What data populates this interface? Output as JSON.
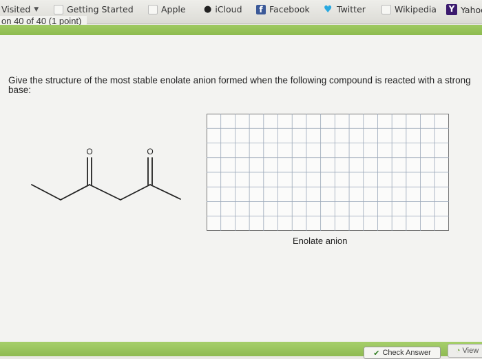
{
  "bookmarks": {
    "most_visited": "Visited",
    "items": [
      {
        "label": "Getting Started",
        "icon": "page-icon"
      },
      {
        "label": "Apple",
        "icon": "page-icon"
      },
      {
        "label": "iCloud",
        "icon": "apple-icon"
      },
      {
        "label": "Facebook",
        "icon": "facebook-icon"
      },
      {
        "label": "Twitter",
        "icon": "twitter-icon"
      },
      {
        "label": "Wikipedia",
        "icon": "page-icon"
      },
      {
        "label": "Yahoo",
        "icon": "yahoo-icon"
      }
    ]
  },
  "question_number": "on 40 of 40 (1 point)",
  "question_text": "Give the structure of the most stable enolate anion formed when the following compound is reacted with a strong base:",
  "molecule_atoms": {
    "o1": "O",
    "o2": "O"
  },
  "answer_label": "Enolate anion",
  "buttons": {
    "check_answer": "Check Answer",
    "view": "View"
  },
  "colors": {
    "accent_green": "#8dbb4f"
  }
}
